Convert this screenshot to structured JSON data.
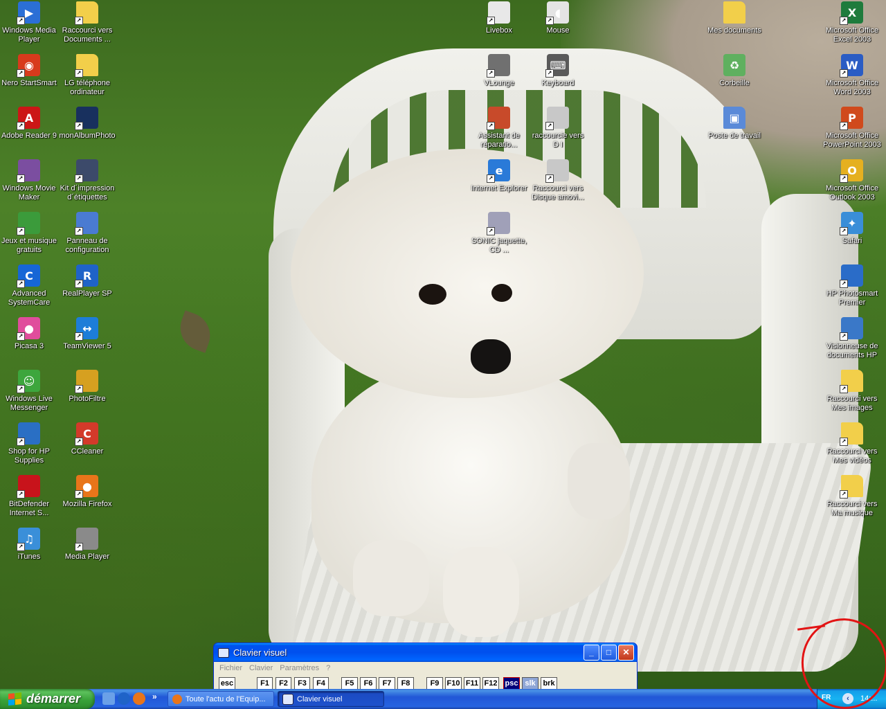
{
  "desktop": {
    "icons_left_col1": [
      {
        "label": "Windows Media Player",
        "icon": "windows-media-player-icon",
        "color": "#2b6fd6"
      },
      {
        "label": "Nero StartSmart",
        "icon": "nero-icon",
        "color": "#d83a1c"
      },
      {
        "label": "Adobe Reader 9",
        "icon": "adobe-reader-icon",
        "color": "#cc1616"
      },
      {
        "label": "Windows Movie Maker",
        "icon": "movie-maker-icon",
        "color": "#7b4ea0"
      },
      {
        "label": "Jeux et musique gratuits",
        "icon": "gift-icon",
        "color": "#3b9b3b"
      },
      {
        "label": "Advanced SystemCare",
        "icon": "systemcare-icon",
        "color": "#1666d6"
      },
      {
        "label": "Picasa 3",
        "icon": "picasa-icon",
        "color": "#e04d9c"
      },
      {
        "label": "Windows Live Messenger",
        "icon": "messenger-icon",
        "color": "#3da63d"
      },
      {
        "label": "Shop for HP Supplies",
        "icon": "hp-shop-icon",
        "color": "#2a6fc4"
      },
      {
        "label": "BitDefender Internet S...",
        "icon": "bitdefender-icon",
        "color": "#c8131b"
      },
      {
        "label": "iTunes",
        "icon": "itunes-icon",
        "color": "#3a8fd9"
      }
    ],
    "icons_left_col2": [
      {
        "label": "Raccourci vers Documents ...",
        "icon": "folder-icon",
        "color": "#f2cf4a"
      },
      {
        "label": "LG téléphone ordinateur",
        "icon": "folder-icon",
        "color": "#f2cf4a"
      },
      {
        "label": "monAlbumPhoto",
        "icon": "album-photo-icon",
        "color": "#18305e"
      },
      {
        "label": "Kit d´impression d´étiquettes",
        "icon": "label-printing-icon",
        "color": "#3c4a6a"
      },
      {
        "label": "Panneau de configuration",
        "icon": "control-panel-icon",
        "color": "#4a7bd2"
      },
      {
        "label": "RealPlayer SP",
        "icon": "realplayer-icon",
        "color": "#1f63c8"
      },
      {
        "label": "TeamViewer 5",
        "icon": "teamviewer-icon",
        "color": "#1d7dd8"
      },
      {
        "label": "PhotoFiltre",
        "icon": "photofiltre-icon",
        "color": "#d6a020"
      },
      {
        "label": "CCleaner",
        "icon": "ccleaner-icon",
        "color": "#d33a2a"
      },
      {
        "label": "Mozilla Firefox",
        "icon": "firefox-icon",
        "color": "#e8751a"
      },
      {
        "label": "Media Player",
        "icon": "media-player-icon",
        "color": "#8a8a8a"
      }
    ],
    "icons_mid_col1": [
      {
        "label": "Livebox",
        "icon": "livebox-icon",
        "color": "#e8e8e8"
      },
      {
        "label": "VLounge",
        "icon": "vlounge-icon",
        "color": "#707070"
      },
      {
        "label": "Assistant de réparatio...",
        "icon": "repair-assistant-icon",
        "color": "#c84a2a"
      },
      {
        "label": "Internet Explorer",
        "icon": "internet-explorer-icon",
        "color": "#2a7ad8"
      },
      {
        "label": "SONIC jaquette, CD ...",
        "icon": "sonic-cd-icon",
        "color": "#a0a0b8"
      }
    ],
    "icons_mid_col2": [
      {
        "label": "Mouse",
        "icon": "mouse-icon",
        "color": "#e4e4e4"
      },
      {
        "label": "Keyboard",
        "icon": "keyboard-icon",
        "color": "#5a5a5a"
      },
      {
        "label": "raccourcie vers D I",
        "icon": "drive-icon",
        "color": "#c8c8c8"
      },
      {
        "label": "Raccourci vers Disque amovi...",
        "icon": "removable-disk-icon",
        "color": "#c8c8c8"
      }
    ],
    "icons_right_col1": [
      {
        "label": "Mes documents",
        "icon": "my-documents-icon",
        "color": "#f2cf4a"
      },
      {
        "label": "Corbeille",
        "icon": "recycle-bin-icon",
        "color": "#5fb05f"
      },
      {
        "label": "Poste de travail",
        "icon": "my-computer-icon",
        "color": "#5a8ad8"
      }
    ],
    "icons_right_col2": [
      {
        "label": "Microsoft Office Excel 2003",
        "icon": "excel-icon",
        "color": "#1e7b3c"
      },
      {
        "label": "Microsoft Office Word 2003",
        "icon": "word-icon",
        "color": "#2a5cc4"
      },
      {
        "label": "Microsoft Office PowerPoint 2003",
        "icon": "powerpoint-icon",
        "color": "#d04a1c"
      },
      {
        "label": "Microsoft Office Outlook 2003",
        "icon": "outlook-icon",
        "color": "#e5b020"
      },
      {
        "label": "Safari",
        "icon": "safari-icon",
        "color": "#3a8ed8"
      },
      {
        "label": "HP Photosmart Premier",
        "icon": "hp-photosmart-icon",
        "color": "#2a6cc8"
      },
      {
        "label": "Visionneuse de documents HP",
        "icon": "hp-doc-viewer-icon",
        "color": "#3a78c8"
      },
      {
        "label": "Raccourci vers Mes images",
        "icon": "my-pictures-icon",
        "color": "#f2cf4a"
      },
      {
        "label": "Raccourci vers Mes vidéos",
        "icon": "my-videos-icon",
        "color": "#f2cf4a"
      },
      {
        "label": "Raccourci vers Ma musique",
        "icon": "my-music-icon",
        "color": "#f2cf4a"
      }
    ]
  },
  "osk": {
    "title": "Clavier visuel",
    "menu": [
      "Fichier",
      "Clavier",
      "Paramètres",
      "?"
    ],
    "keys": [
      "esc",
      "F1",
      "F2",
      "F3",
      "F4",
      "F5",
      "F6",
      "F7",
      "F8",
      "F9",
      "F10",
      "F11",
      "F12",
      "psc",
      "slk",
      "brk"
    ],
    "active_key": "psc",
    "highlight_key": "slk"
  },
  "taskbar": {
    "start_label": "démarrer",
    "quicklaunch_more": "»",
    "tasks": [
      {
        "label": "Toute l'actu de l'Equip...",
        "icon": "firefox-icon",
        "active": false
      },
      {
        "label": "Clavier visuel",
        "icon": "keyboard-window-icon",
        "active": true
      }
    ],
    "tray": {
      "language": "FR",
      "clock": "14:..."
    }
  },
  "colors": {
    "annotation_circle": "#e21414",
    "taskbar_blue": "#2157d7",
    "start_green": "#3aa23a"
  }
}
